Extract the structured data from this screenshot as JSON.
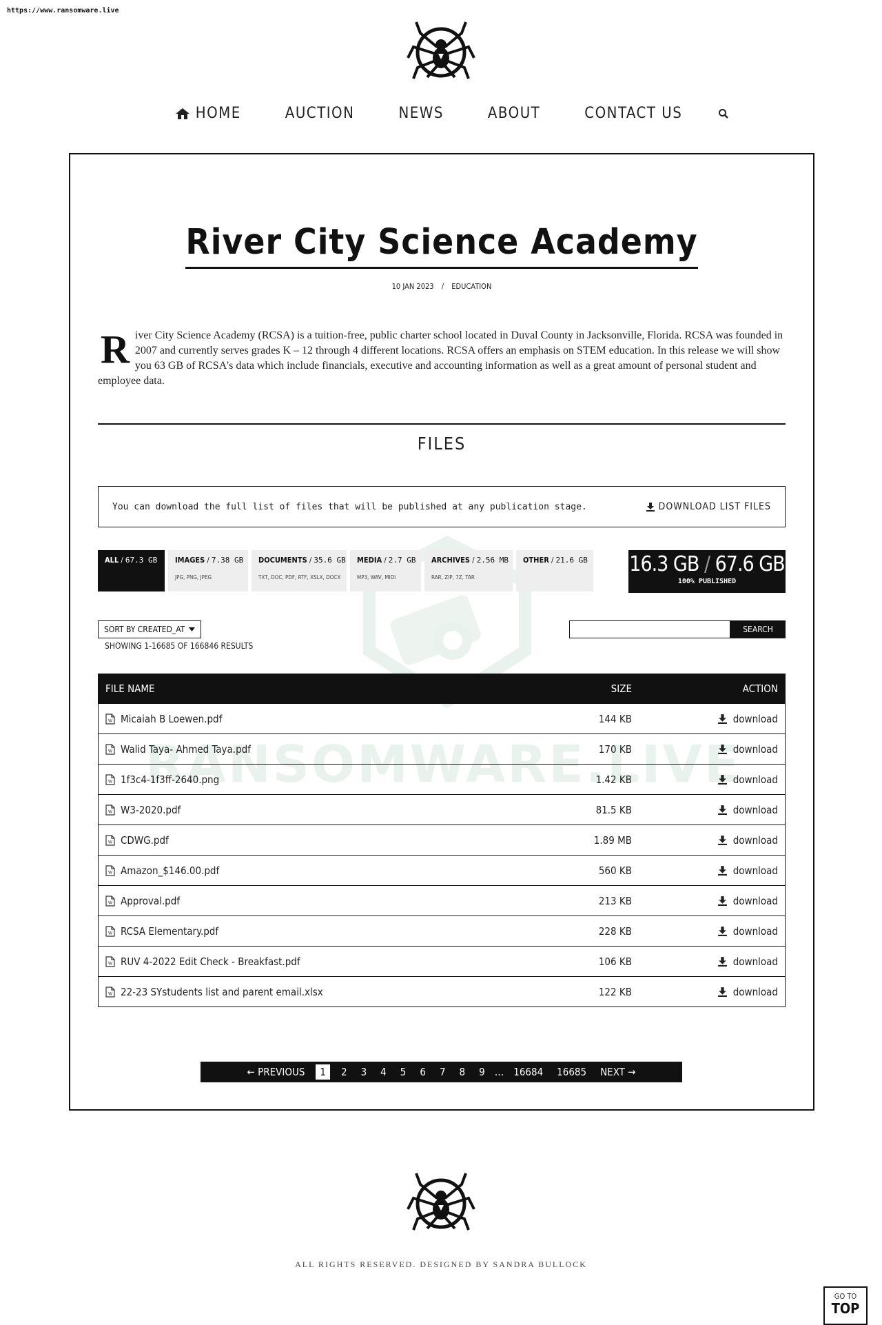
{
  "url": "https://www.ransomware.live",
  "nav": {
    "items": [
      "HOME",
      "AUCTION",
      "NEWS",
      "ABOUT",
      "CONTACT US"
    ]
  },
  "post": {
    "title": "River City Science Academy",
    "date": "10 JAN 2023",
    "separator": "/",
    "category": "EDUCATION",
    "dropcap": "R",
    "body": "iver City Science Academy (RCSA) is a tuition-free, public charter school located in Duval County in Jacksonville, Florida. RCSA was founded in 2007 and currently serves grades K – 12 through 4 different locations. RCSA offers an emphasis on STEM education. In this release we will show you 63 GB of RCSA's data which include financials, executive and accounting information as well as a great amount of personal student and employee data."
  },
  "files": {
    "heading": "FILES",
    "notice": "You can download the full list of files that will be published at any publication stage.",
    "download_list_label": "DOWNLOAD LIST FILES",
    "categories": [
      {
        "name": "ALL",
        "size": "67.3 GB",
        "sub": "",
        "active": true
      },
      {
        "name": "IMAGES",
        "size": "7.38 GB",
        "sub": "JPG, PNG, JPEG",
        "active": false
      },
      {
        "name": "DOCUMENTS",
        "size": "35.6 GB",
        "sub": "TXT, DOC, PDF, RTF, XSLX, DOCX",
        "active": false
      },
      {
        "name": "MEDIA",
        "size": "2.7 GB",
        "sub": "MP3, WAV, MIDI",
        "active": false
      },
      {
        "name": "ARCHIVES",
        "size": "2.56 MB",
        "sub": "RAR, ZIP, 7Z, TAR",
        "active": false
      },
      {
        "name": "OTHER",
        "size": "21.6 GB",
        "sub": "",
        "active": false
      }
    ],
    "stats": {
      "published": "16.3 GB",
      "slash": "/",
      "total": "67.6 GB",
      "percent_label": "100% PUBLISHED"
    },
    "sort_label": "SORT BY CREATED_AT",
    "showing": "SHOWING 1-16685 OF 166846 RESULTS",
    "search": {
      "value": "",
      "button": "SEARCH"
    },
    "table": {
      "headers": {
        "name": "FILE NAME",
        "size": "SIZE",
        "action": "ACTION"
      },
      "action_label": "download",
      "rows": [
        {
          "name": "Micaiah B Loewen.pdf",
          "size": "144 KB"
        },
        {
          "name": "Walid Taya- Ahmed Taya.pdf",
          "size": "170 KB"
        },
        {
          "name": "1f3c4-1f3ff-2640.png",
          "size": "1.42 KB"
        },
        {
          "name": "W3-2020.pdf",
          "size": "81.5 KB"
        },
        {
          "name": "CDWG.pdf",
          "size": "1.89 MB"
        },
        {
          "name": "Amazon_$146.00.pdf",
          "size": "560 KB"
        },
        {
          "name": "Approval.pdf",
          "size": "213 KB"
        },
        {
          "name": "RCSA Elementary.pdf",
          "size": "228 KB"
        },
        {
          "name": "RUV 4-2022 Edit Check - Breakfast.pdf",
          "size": "106 KB"
        },
        {
          "name": "22-23 SYstudents list and parent email.xlsx",
          "size": "122 KB"
        }
      ]
    },
    "pagination": {
      "previous": "← PREVIOUS",
      "pages": [
        "1",
        "2",
        "3",
        "4",
        "5",
        "6",
        "7",
        "8",
        "9"
      ],
      "current": "1",
      "ellipsis": "…",
      "last_pages": [
        "16684",
        "16685"
      ],
      "next": "NEXT →"
    }
  },
  "footer": {
    "text": "ALL RIGHTS RESERVED. DESIGNED BY SANDRA BULLOCK",
    "gotop_small": "GO TO",
    "gotop_big": "TOP"
  },
  "watermark": {
    "text": "RANSOMWARE.LIVE",
    "color": "#cfe3d8"
  }
}
